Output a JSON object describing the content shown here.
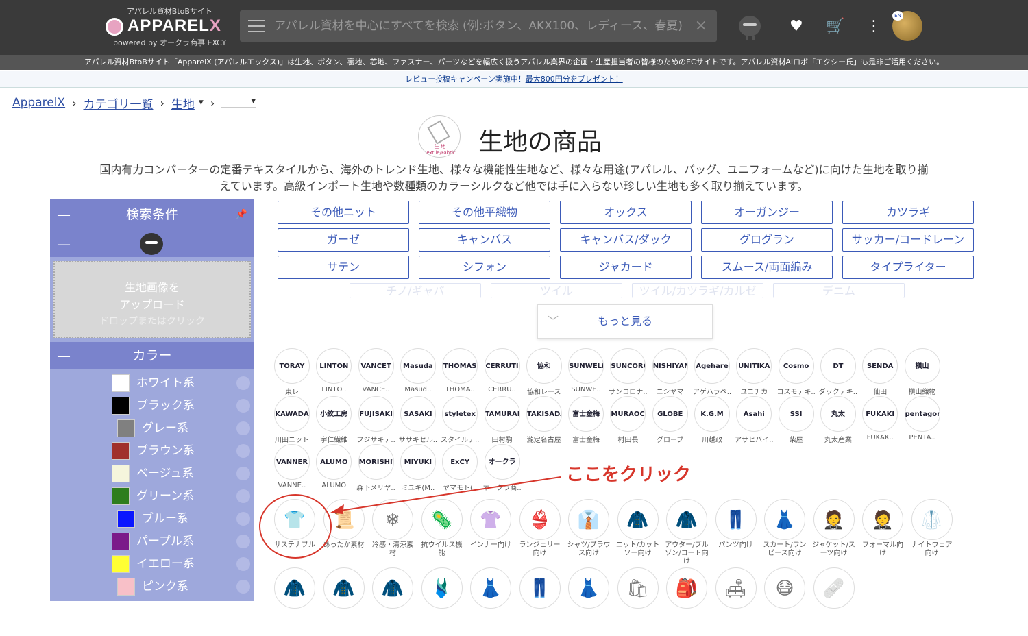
{
  "header": {
    "sub": "アパレル資材BtoBサイト",
    "brand_a": "APPAREL",
    "brand_x": "X",
    "powered": "powered by オークラ商事 EXCY",
    "search_placeholder": "アパレル資材を中心にすべてを検索 (例:ボタン、AKX100、レディース、春夏)",
    "clear": "×",
    "cart": "🛒",
    "heart": "♥",
    "kebab": "⋮",
    "flag": "EN"
  },
  "infobar": "アパレル資材BtoBサイト「ApparelX (アパレルエックス)」は生地、ボタン、裏地、芯地、ファスナー、パーツなどを幅広く扱うアパレル業界の企画・生産担当者の皆様のためのECサイトです。アパレル資材AIロボ「エクシー氏」も是非ご活用ください。",
  "campaign": {
    "text": "レビュー投稿キャンペーン実施中！",
    "link": "最大800円分をプレゼント！"
  },
  "breadcrumb": {
    "home": "ApparelX",
    "cat": "カテゴリ一覧",
    "fabric": "生地",
    "sep": "›",
    "dd": "▼"
  },
  "page": {
    "logo_label": "生 地",
    "logo_sub": "Textile/Fabric",
    "title": "生地の商品",
    "desc": "国内有力コンバーターの定番テキスタイルから、海外のトレンド生地、様々な機能性生地など、様々な用途(アパレル、バッグ、ユニフォームなど)に向けた生地を取り揃えています。高級インポート生地や数種類のカラーシルクなど他では手に入らない珍しい生地も多く取り揃えています。"
  },
  "sidebar": {
    "minus": "—",
    "pin": "📌",
    "title": "検索条件",
    "upload1": "生地画像を",
    "upload2": "アップロード",
    "upload3": "ドロップまたはクリック",
    "color_title": "カラー",
    "colors": [
      {
        "label": "ホワイト系",
        "hex": "#ffffff"
      },
      {
        "label": "ブラック系",
        "hex": "#000000"
      },
      {
        "label": "グレー系",
        "hex": "#808080"
      },
      {
        "label": "ブラウン系",
        "hex": "#a0302b"
      },
      {
        "label": "ベージュ系",
        "hex": "#f5f5dc"
      },
      {
        "label": "グリーン系",
        "hex": "#2e7d1e"
      },
      {
        "label": "ブルー系",
        "hex": "#0a17ff"
      },
      {
        "label": "パープル系",
        "hex": "#7b1a8a"
      },
      {
        "label": "イエロー系",
        "hex": "#ffff33"
      },
      {
        "label": "ピンク系",
        "hex": "#f8c0c8"
      }
    ]
  },
  "categories": [
    "その他ニット",
    "その他平織物",
    "オックス",
    "オーガンジー",
    "カツラギ",
    "ガーゼ",
    "キャンバス",
    "キャンバス/ダック",
    "グログラン",
    "サッカー/コードレーン",
    "サテン",
    "シフォン",
    "ジャカード",
    "スムース/両面編み",
    "タイプライター",
    "チノ/ギャバ",
    "ツイル",
    "ツイル/カツラギ/カルゼ",
    "デニム"
  ],
  "more": "もっと見る",
  "chev": "﹀",
  "brands": [
    {
      "logo": "TORAY",
      "name": "東レ"
    },
    {
      "logo": "LINTON",
      "name": "LINTO.."
    },
    {
      "logo": "VANCET",
      "name": "VANCE.."
    },
    {
      "logo": "Masuda",
      "name": "Masud.."
    },
    {
      "logo": "THOMAS",
      "name": "THOMA.."
    },
    {
      "logo": "CERRUTI",
      "name": "CERRU.."
    },
    {
      "logo": "協和",
      "name": "協和レース"
    },
    {
      "logo": "SUNWELL",
      "name": "SUNWE.."
    },
    {
      "logo": "SUNCORONA",
      "name": "サンコロナ.."
    },
    {
      "logo": "NISHIYAMA",
      "name": "ニシヤマ"
    },
    {
      "logo": "Agehare",
      "name": "アゲハラベ.."
    },
    {
      "logo": "UNITIKA",
      "name": "ユニチカ"
    },
    {
      "logo": "Cosmo",
      "name": "コスモテキ.."
    },
    {
      "logo": "DT",
      "name": "ダックテキ.."
    },
    {
      "logo": "SENDA",
      "name": "仙田"
    },
    {
      "logo": "槇山",
      "name": "槇山織物"
    },
    {
      "logo": "KAWADA",
      "name": "川田ニット"
    },
    {
      "logo": "小紋工房",
      "name": "宇仁繊維"
    },
    {
      "logo": "FUJISAKI",
      "name": "フジサキテ.."
    },
    {
      "logo": "SASAKI",
      "name": "ササキセル.."
    },
    {
      "logo": "styletex",
      "name": "スタイルテ.."
    },
    {
      "logo": "TAMURAKOMA",
      "name": "田村駒"
    },
    {
      "logo": "TAKISADA",
      "name": "瀧定名古屋"
    },
    {
      "logo": "富士金梅",
      "name": "富士金梅"
    },
    {
      "logo": "MURAOCHO",
      "name": "村田長"
    },
    {
      "logo": "GLOBE",
      "name": "グローブ"
    },
    {
      "logo": "K.G.M",
      "name": "川越政"
    },
    {
      "logo": "Asahi",
      "name": "アサヒバイ.."
    },
    {
      "logo": "SSI",
      "name": "柴屋"
    },
    {
      "logo": "丸太",
      "name": "丸太産業"
    },
    {
      "logo": "FUKAKI",
      "name": "FUKAK.."
    },
    {
      "logo": "pentagon",
      "name": "PENTA.."
    },
    {
      "logo": "VANNER",
      "name": "VANNE.."
    },
    {
      "logo": "ALUMO",
      "name": "ALUMO"
    },
    {
      "logo": "MORISHITA",
      "name": "森下メリヤ.."
    },
    {
      "logo": "MIYUKI",
      "name": "ミユキ(M.."
    },
    {
      "logo": "ExCY",
      "name": "ヤマモト(.."
    },
    {
      "logo": "オークラ",
      "name": "オークラ商.."
    }
  ],
  "usages": [
    {
      "icon": "👕",
      "name": "サステナブル"
    },
    {
      "icon": "📜",
      "name": "あったか素材"
    },
    {
      "icon": "❄",
      "name": "冷感・清涼素材"
    },
    {
      "icon": "🦠",
      "name": "抗ウイルス機能"
    },
    {
      "icon": "👚",
      "name": "インナー向け"
    },
    {
      "icon": "👙",
      "name": "ランジェリー向け"
    },
    {
      "icon": "👔",
      "name": "シャツ/ブラウス向け"
    },
    {
      "icon": "🧥",
      "name": "ニット/カットソー向け"
    },
    {
      "icon": "🧥",
      "name": "アウター/ブルゾン/コート向け"
    },
    {
      "icon": "👖",
      "name": "パンツ向け"
    },
    {
      "icon": "👗",
      "name": "スカート/ワンピース向け"
    },
    {
      "icon": "🤵",
      "name": "ジャケット/スーツ向け"
    },
    {
      "icon": "🤵",
      "name": "フォーマル向け"
    },
    {
      "icon": "🥼",
      "name": "ナイトウェア向け"
    },
    {
      "icon": "🧥",
      "name": ""
    },
    {
      "icon": "🧥",
      "name": ""
    },
    {
      "icon": "🧥",
      "name": ""
    },
    {
      "icon": "🩱",
      "name": ""
    },
    {
      "icon": "👗",
      "name": ""
    },
    {
      "icon": "👖",
      "name": ""
    },
    {
      "icon": "👗",
      "name": ""
    },
    {
      "icon": "🛍",
      "name": ""
    },
    {
      "icon": "🎒",
      "name": ""
    },
    {
      "icon": "🛋",
      "name": ""
    },
    {
      "icon": "😷",
      "name": ""
    },
    {
      "icon": "🩹",
      "name": ""
    }
  ],
  "annotation": "ここをクリック"
}
